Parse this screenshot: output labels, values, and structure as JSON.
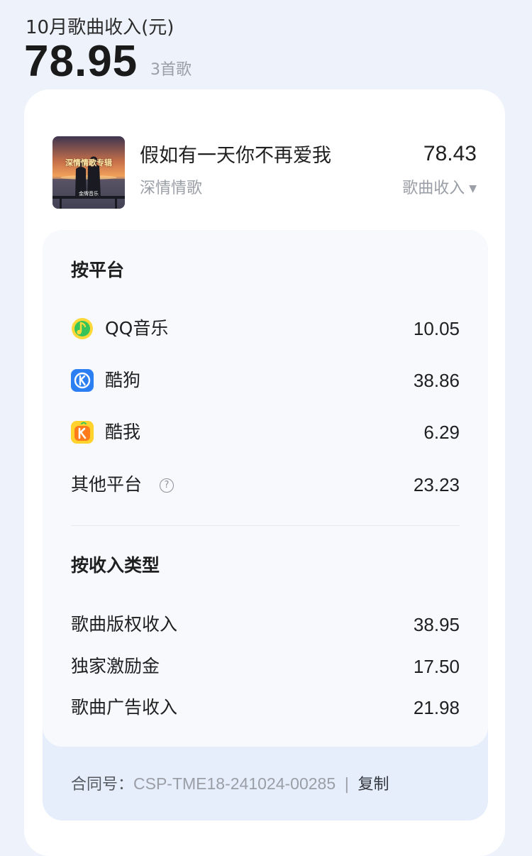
{
  "header": {
    "title": "10月歌曲收入(元)",
    "total": "78.95",
    "song_count": "3首歌"
  },
  "song": {
    "title": "假如有一天你不再爱我",
    "subtitle": "深情情歌",
    "amount": "78.43",
    "dropdown_label": "歌曲收入",
    "cover_text": "深情情歌专辑",
    "cover_subtext": "金牌音乐"
  },
  "by_platform": {
    "heading": "按平台",
    "items": [
      {
        "name": "QQ音乐",
        "value": "10.05",
        "icon": "qq-music-icon"
      },
      {
        "name": "酷狗",
        "value": "38.86",
        "icon": "kugou-icon"
      },
      {
        "name": "酷我",
        "value": "6.29",
        "icon": "kuwo-icon"
      },
      {
        "name": "其他平台",
        "value": "23.23",
        "icon": "help-circle-icon"
      }
    ]
  },
  "by_type": {
    "heading": "按收入类型",
    "items": [
      {
        "name": "歌曲版权收入",
        "value": "38.95"
      },
      {
        "name": "独家激励金",
        "value": "17.50"
      },
      {
        "name": "歌曲广告收入",
        "value": "21.98"
      }
    ]
  },
  "contract": {
    "label": "合同号：",
    "number": "CSP-TME18-241024-00285",
    "separator": "|",
    "copy_label": "复制"
  },
  "colors": {
    "page_background": "#eef3fb",
    "qq_music_green": "#36c45a",
    "qq_music_yellow": "#ffd83a",
    "kugou_blue": "#2b7ff3",
    "kuwo_yellow": "#ffd22e",
    "kuwo_orange": "#ff7a1a"
  }
}
